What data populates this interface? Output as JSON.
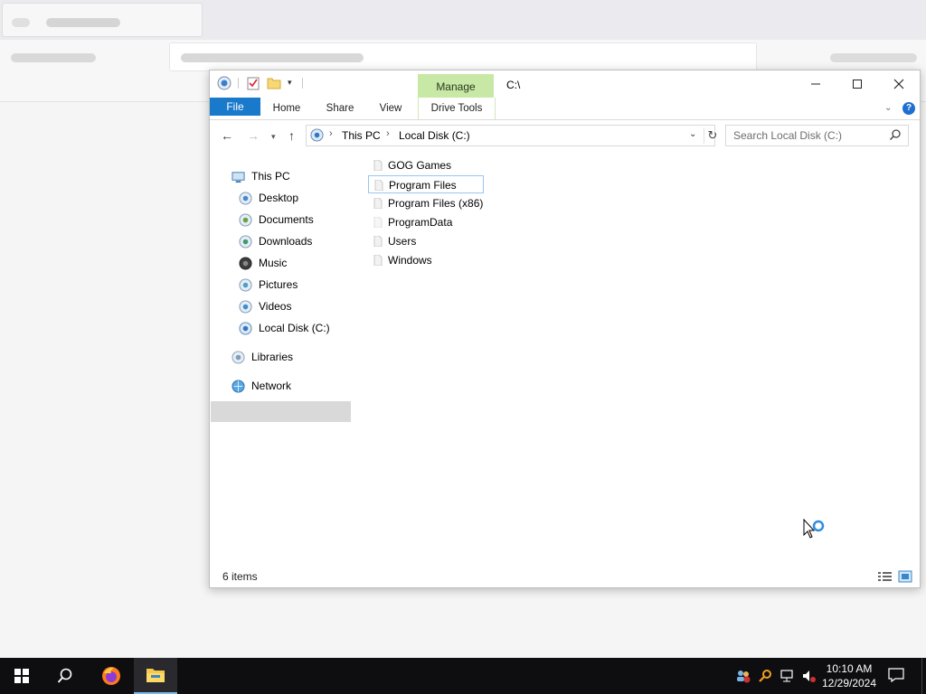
{
  "explorer": {
    "title": "C:\\",
    "contextual_tab": "Manage",
    "ribbon_tabs": [
      "File",
      "Home",
      "Share",
      "View",
      "Drive Tools"
    ],
    "address": {
      "crumbs": [
        "This PC",
        "Local Disk (C:)"
      ]
    },
    "search": {
      "placeholder": "Search Local Disk (C:)"
    },
    "nav": {
      "this_pc": "This PC",
      "items": [
        "Desktop",
        "Documents",
        "Downloads",
        "Music",
        "Pictures",
        "Videos",
        "Local Disk (C:)"
      ],
      "libraries": "Libraries",
      "network": "Network"
    },
    "files": [
      "GOG Games",
      "Program Files",
      "Program Files (x86)",
      "ProgramData",
      "Users",
      "Windows"
    ],
    "status": "6 items"
  },
  "taskbar": {
    "time": "10:10 AM",
    "date": "12/29/2024"
  },
  "colors": {
    "file_tab": "#1979ca",
    "manage_tab": "#c8e8a5",
    "taskbar": "#0e0e10",
    "selection": "#d9d9d9"
  }
}
